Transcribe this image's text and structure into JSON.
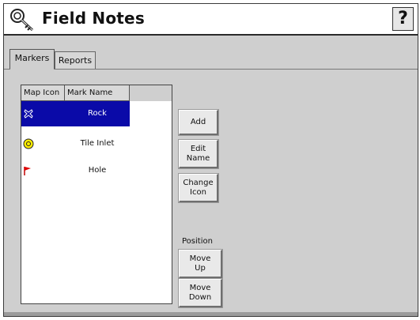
{
  "header": {
    "title": "Field Notes",
    "help_label": "?",
    "app_icon": "key-icon"
  },
  "tabs": [
    {
      "label": "Markers",
      "active": true
    },
    {
      "label": "Reports",
      "active": false
    }
  ],
  "markers_table": {
    "columns": [
      "Map Icon",
      "Mark Name"
    ],
    "rows": [
      {
        "icon": "rock-marker-icon",
        "name": "Rock",
        "selected": true
      },
      {
        "icon": "yellow-circle-marker-icon",
        "name": "Tile Inlet",
        "selected": false
      },
      {
        "icon": "red-flag-marker-icon",
        "name": "Hole",
        "selected": false
      }
    ]
  },
  "actions": {
    "add": "Add",
    "edit_name": [
      "Edit",
      "Name"
    ],
    "change_icon": [
      "Change",
      "Icon"
    ],
    "position_label": "Position",
    "move_up": [
      "Move",
      "Up"
    ],
    "move_down": [
      "Move",
      "Down"
    ]
  },
  "colors": {
    "selection": "#0a0aa8",
    "panel_bg": "#cfcfcf"
  }
}
